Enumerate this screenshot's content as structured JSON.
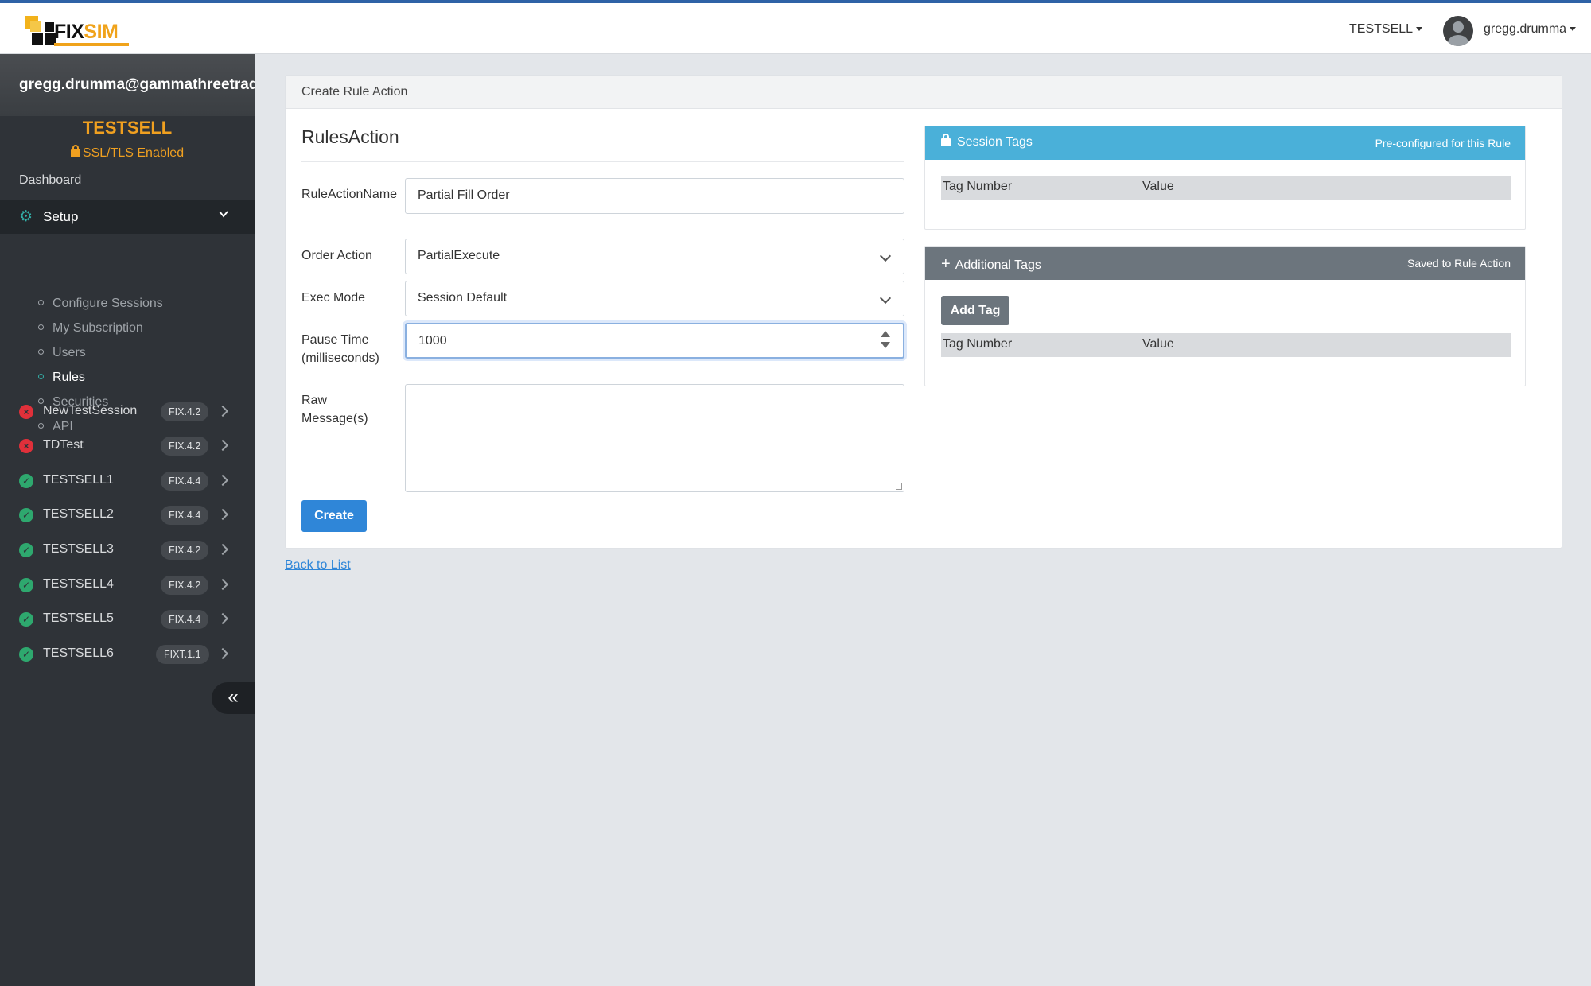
{
  "brand": {
    "logo_text_a": "FIX",
    "logo_text_b": "SIM"
  },
  "topbar": {
    "env_label": "TESTSELL",
    "user_label": "gregg.drumma"
  },
  "sidebar": {
    "email": "gregg.drumma@gammathreetradi",
    "env": "TESTSELL",
    "ssl": "SSL/TLS Enabled",
    "dashboard": "Dashboard",
    "setup": "Setup",
    "subnav": [
      {
        "label": "Configure Sessions"
      },
      {
        "label": "My Subscription"
      },
      {
        "label": "Users"
      },
      {
        "label": "Rules"
      },
      {
        "label": "Securities"
      },
      {
        "label": "API"
      }
    ],
    "sessions": [
      {
        "name": "NewTestSession",
        "version": "FIX.4.2",
        "status": "error"
      },
      {
        "name": "TDTest",
        "version": "FIX.4.2",
        "status": "error"
      },
      {
        "name": "TESTSELL1",
        "version": "FIX.4.4",
        "status": "ok"
      },
      {
        "name": "TESTSELL2",
        "version": "FIX.4.4",
        "status": "ok"
      },
      {
        "name": "TESTSELL3",
        "version": "FIX.4.2",
        "status": "ok"
      },
      {
        "name": "TESTSELL4",
        "version": "FIX.4.2",
        "status": "ok"
      },
      {
        "name": "TESTSELL5",
        "version": "FIX.4.4",
        "status": "ok"
      },
      {
        "name": "TESTSELL6",
        "version": "FIXT.1.1",
        "status": "ok"
      }
    ],
    "collapse_icon": "«"
  },
  "card": {
    "header": "Create Rule Action",
    "title": "RulesAction",
    "fields": {
      "name_label": "RuleActionName",
      "name_value": "Partial Fill Order",
      "order_action_label": "Order Action",
      "order_action_value": "PartialExecute",
      "exec_mode_label": "Exec Mode",
      "exec_mode_value": "Session Default",
      "pause_label": "Pause Time (milliseconds)",
      "pause_value": "1000",
      "raw_label": "Raw Message(s)",
      "raw_value": ""
    },
    "create_button": "Create"
  },
  "session_tags": {
    "title": "Session Tags",
    "subtitle": "Pre-configured for this Rule",
    "col_tag": "Tag Number",
    "col_value": "Value"
  },
  "additional_tags": {
    "title": "Additional Tags",
    "subtitle": "Saved to Rule Action",
    "add_button": "Add Tag",
    "col_tag": "Tag Number",
    "col_value": "Value"
  },
  "back_link": "Back to List",
  "colors": {
    "accent": "#2f86d8",
    "session_tags_header": "#4ab0d9",
    "additional_tags_header": "#6c757d",
    "sidebar_bg": "#2f3338",
    "env_orange": "#f0a020",
    "status_ok": "#2ea86e",
    "status_error": "#e0303a"
  }
}
